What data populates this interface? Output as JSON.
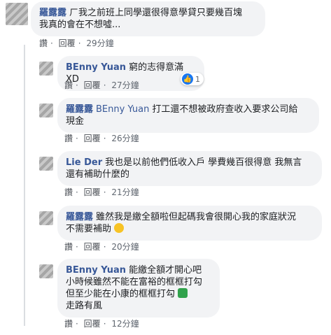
{
  "comments": [
    {
      "name": "羅露露",
      "text_line1": "ㄏ我之前班上同學還很得意學貸只要幾百塊",
      "text_line2": "我真的會在不想噓...",
      "like": "讚",
      "reply": "回覆",
      "time": "29分鐘"
    }
  ],
  "replies": [
    {
      "name": "BEnny Yuan",
      "text": "窮的志得意滿XD",
      "like": "讚",
      "reply": "回覆",
      "time": "27分鐘",
      "reaction_count": "1"
    },
    {
      "name": "羅露露",
      "mention": "BEnny Yuan",
      "text_line1": "打工還不想被政府查收入要求公司給",
      "text_line2": "現金",
      "like": "讚",
      "reply": "回覆",
      "time": "26分鐘"
    },
    {
      "name": "Lie Der",
      "text_line1": "我也是以前他們低收入戶 學費幾百很得意 我無言",
      "text_line2": "還有補助什麼的",
      "like": "讚",
      "reply": "回覆",
      "time": "21分鐘"
    },
    {
      "name": "羅露露",
      "text_line1": "雖然我是繳全額啦但起碼我會很開心我的家庭狀況",
      "text_line2": "不需要補助",
      "like": "讚",
      "reply": "回覆",
      "time": "20分鐘"
    },
    {
      "name": "BEnny Yuan",
      "text_line1": "能繳全額才開心吧",
      "text_line2": "小時候雖然不能在富裕的框框打勾",
      "text_line3": "但至少能在小康的框框打勾",
      "text_line4": "走路有風",
      "like": "讚",
      "reply": "回覆",
      "time": "12分鐘"
    }
  ],
  "separator": "·",
  "colors": {
    "name": "#385898",
    "bubble": "#f2f3f5",
    "like": "#1877f2",
    "check": "#31a24c"
  }
}
